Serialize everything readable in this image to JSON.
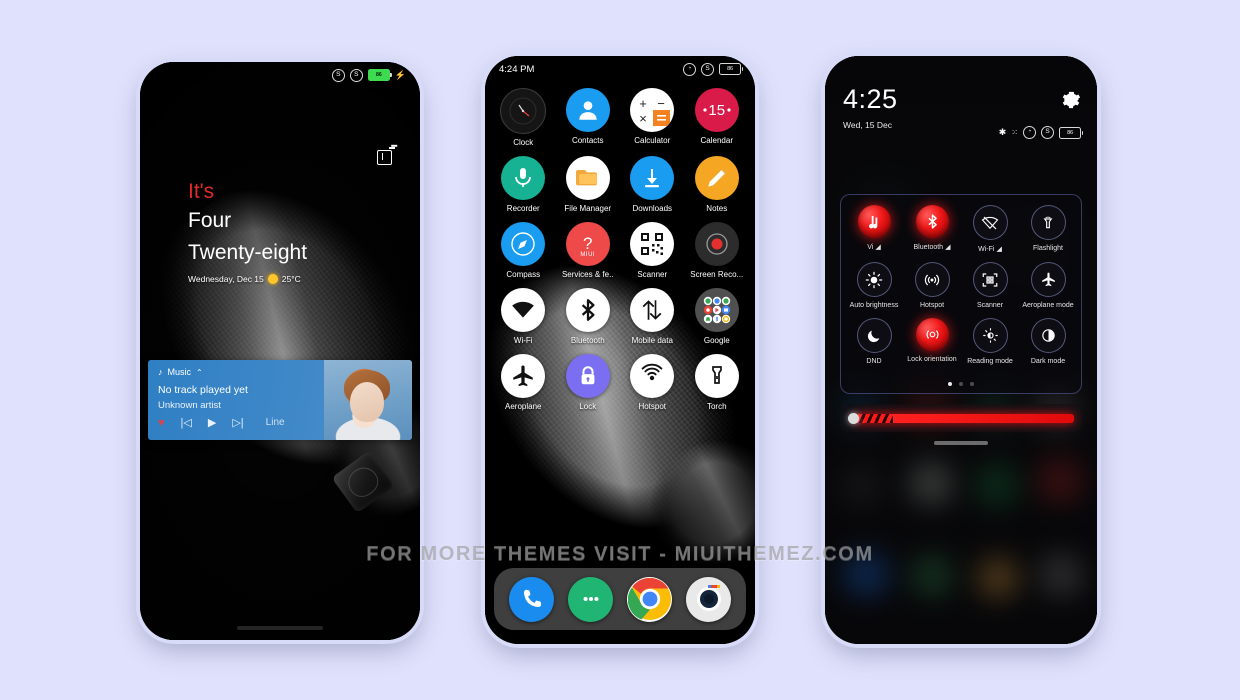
{
  "canvas": {
    "background": "#e0e2fd",
    "watermark": "FOR MORE THEMES VISIT - MIUITHEMEZ.COM"
  },
  "phone1": {
    "name": "lock-screen",
    "statusbar": {
      "left": "",
      "battery": "86"
    },
    "clock": {
      "line1": "It's",
      "line2": "Four",
      "line3": "Twenty-eight",
      "date": "Wednesday, Dec 15",
      "temperature": "25°C"
    },
    "music": {
      "app": "Music",
      "track": "No track played yet",
      "artist": "Unknown artist",
      "output": "Line",
      "collapse": "˄",
      "note_icon": "music-note-icon",
      "controls": [
        "favorite-icon",
        "⏮",
        "▶",
        "⏭"
      ]
    }
  },
  "phone2": {
    "name": "home-screen",
    "statusbar": {
      "time": "4:24 PM",
      "battery": "86"
    },
    "apps": [
      {
        "label": "Clock",
        "icon": "clock-icon"
      },
      {
        "label": "Contacts",
        "icon": "contacts-icon"
      },
      {
        "label": "Calculator",
        "icon": "calculator-icon"
      },
      {
        "label": "Calendar",
        "icon": "calendar-icon",
        "day": "15"
      },
      {
        "label": "Recorder",
        "icon": "recorder-icon"
      },
      {
        "label": "File Manager",
        "icon": "file-manager-icon"
      },
      {
        "label": "Downloads",
        "icon": "downloads-icon"
      },
      {
        "label": "Notes",
        "icon": "notes-icon"
      },
      {
        "label": "Compass",
        "icon": "compass-icon"
      },
      {
        "label": "Services & fe..",
        "icon": "miui-services-icon",
        "badge": "MIUI"
      },
      {
        "label": "Scanner",
        "icon": "qr-scanner-icon"
      },
      {
        "label": "Screen Reco...",
        "icon": "screen-recorder-icon"
      },
      {
        "label": "Wi-Fi",
        "icon": "wifi-icon"
      },
      {
        "label": "Bluetooth",
        "icon": "bluetooth-icon"
      },
      {
        "label": "Mobile data",
        "icon": "mobile-data-icon"
      },
      {
        "label": "Google",
        "icon": "google-folder-icon"
      },
      {
        "label": "Aeroplane",
        "icon": "aeroplane-icon"
      },
      {
        "label": "Lock",
        "icon": "lock-icon"
      },
      {
        "label": "Hotspot",
        "icon": "hotspot-icon"
      },
      {
        "label": "Torch",
        "icon": "torch-icon"
      }
    ],
    "dock": [
      {
        "label": "Phone",
        "icon": "phone-icon"
      },
      {
        "label": "Messages",
        "icon": "messages-icon"
      },
      {
        "label": "Chrome",
        "icon": "chrome-icon"
      },
      {
        "label": "Camera",
        "icon": "camera-icon"
      }
    ]
  },
  "phone3": {
    "name": "control-center",
    "time": "4:25",
    "date": "Wed, 15 Dec",
    "battery": "86",
    "settings_icon": "gear-icon",
    "toggles": [
      {
        "label": "Vi",
        "icon": "sim-signal-icon",
        "state": "on"
      },
      {
        "label": "Bluetooth",
        "icon": "bluetooth-icon",
        "state": "on"
      },
      {
        "label": "Wi-Fi",
        "icon": "wifi-off-icon",
        "state": "off"
      },
      {
        "label": "Flashlight",
        "icon": "flashlight-icon",
        "state": "off"
      },
      {
        "label": "Auto brightness",
        "icon": "brightness-icon",
        "state": "off"
      },
      {
        "label": "Hotspot",
        "icon": "hotspot-icon",
        "state": "off"
      },
      {
        "label": "Scanner",
        "icon": "scanner-icon",
        "state": "off"
      },
      {
        "label": "Aeroplane mode",
        "icon": "aeroplane-icon",
        "state": "off"
      },
      {
        "label": "DND",
        "icon": "moon-icon",
        "state": "off"
      },
      {
        "label": "Lock orientation",
        "icon": "rotation-lock-icon",
        "state": "on"
      },
      {
        "label": "Reading mode",
        "icon": "reading-mode-icon",
        "state": "off"
      },
      {
        "label": "Dark mode",
        "icon": "dark-mode-icon",
        "state": "off"
      }
    ],
    "pages": 3,
    "active_page": 1,
    "brightness": {
      "icon": "brightness-slider-icon",
      "value": 92
    }
  }
}
